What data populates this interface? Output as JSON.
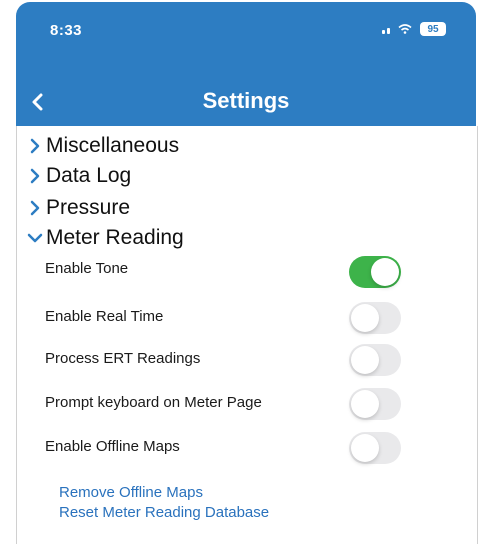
{
  "status_bar": {
    "time": "8:33",
    "battery": "95"
  },
  "nav": {
    "title": "Settings",
    "back_icon": "chevron-left-icon"
  },
  "sections": [
    {
      "label": "Miscellaneous",
      "expanded": false
    },
    {
      "label": "Data Log",
      "expanded": false
    },
    {
      "label": "Pressure",
      "expanded": false
    },
    {
      "label": "Meter Reading",
      "expanded": true
    }
  ],
  "meter_reading": {
    "settings": [
      {
        "label": "Enable Tone",
        "on": true
      },
      {
        "label": "Enable Real Time",
        "on": false
      },
      {
        "label": "Process ERT Readings",
        "on": false
      },
      {
        "label": "Prompt keyboard on Meter Page",
        "on": false
      },
      {
        "label": "Enable Offline Maps",
        "on": false
      }
    ],
    "links": [
      "Remove Offline Maps",
      "Reset Meter Reading Database"
    ]
  },
  "colors": {
    "header": "#2d7dc2",
    "toggle_on": "#3db34a",
    "toggle_off": "#e9e9eb",
    "link": "#2a72bd",
    "chevron": "#2d7dc2"
  }
}
